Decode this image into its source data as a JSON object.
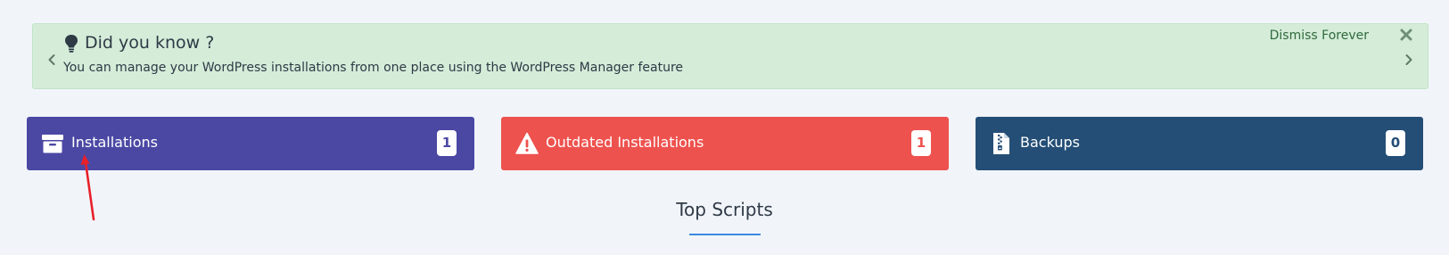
{
  "notice": {
    "title": "Did you know ?",
    "message": "You can manage your WordPress installations from one place using the WordPress Manager feature",
    "dismiss_label": "Dismiss Forever",
    "icon": "lightbulb-icon",
    "background": "#d5ecd9"
  },
  "cards": {
    "installations": {
      "label": "Installations",
      "count": "1",
      "icon": "archive-box-icon",
      "color": "#4b48a4"
    },
    "outdated": {
      "label": "Outdated Installations",
      "count": "1",
      "icon": "warning-triangle-icon",
      "color": "#ee524e"
    },
    "backups": {
      "label": "Backups",
      "count": "0",
      "icon": "zip-file-icon",
      "color": "#244e76"
    }
  },
  "section": {
    "title": "Top Scripts",
    "underline_color": "#3a8ae0"
  },
  "annotation": {
    "color": "#e8202a",
    "points_to": "installations-card"
  }
}
